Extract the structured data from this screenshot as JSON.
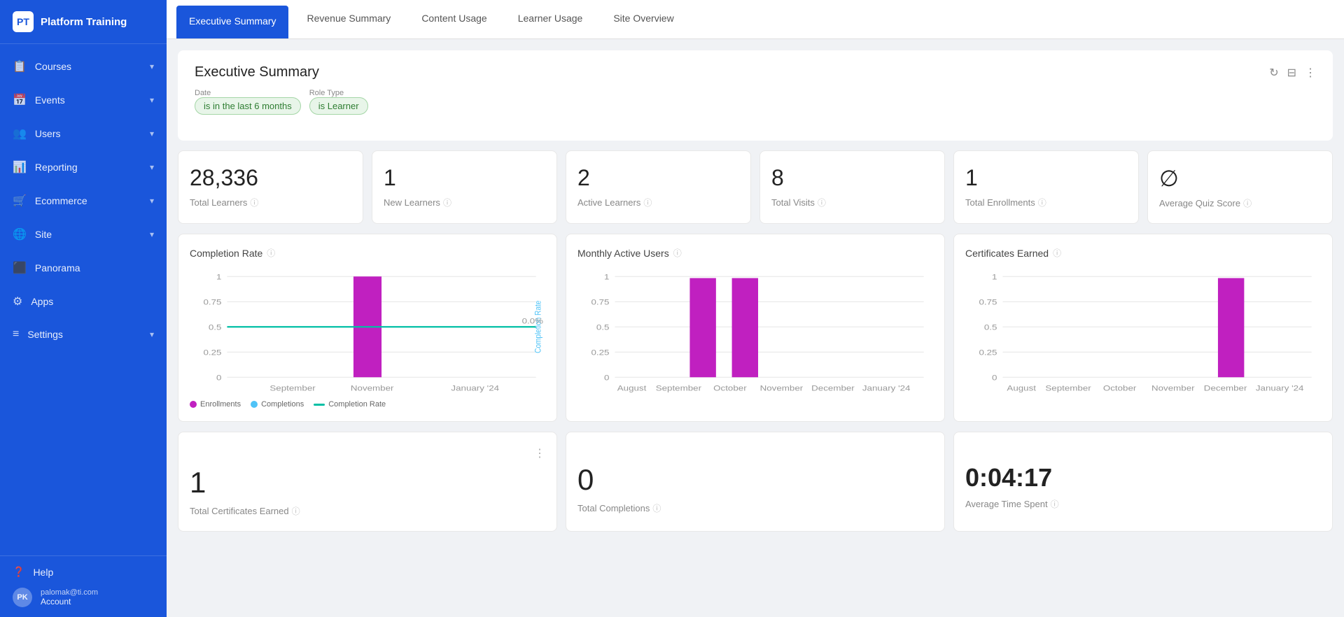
{
  "app": {
    "logo_text": "PT",
    "title": "Platform Training"
  },
  "sidebar": {
    "items": [
      {
        "label": "Courses",
        "icon": "📋",
        "has_chevron": true
      },
      {
        "label": "Events",
        "icon": "📅",
        "has_chevron": true
      },
      {
        "label": "Users",
        "icon": "👥",
        "has_chevron": true
      },
      {
        "label": "Reporting",
        "icon": "📊",
        "has_chevron": true
      },
      {
        "label": "Ecommerce",
        "icon": "🛒",
        "has_chevron": true
      },
      {
        "label": "Site",
        "icon": "🌐",
        "has_chevron": true
      },
      {
        "label": "Panorama",
        "icon": "⬛",
        "has_chevron": false
      },
      {
        "label": "Apps",
        "icon": "⚙",
        "has_chevron": false
      },
      {
        "label": "Settings",
        "icon": "≡",
        "has_chevron": true
      }
    ],
    "footer": {
      "help_label": "Help",
      "user_initials": "PK",
      "user_email": "palomak@ti.com",
      "user_account": "Account"
    }
  },
  "tabs": [
    {
      "label": "Executive Summary",
      "active": true
    },
    {
      "label": "Revenue Summary",
      "active": false
    },
    {
      "label": "Content Usage",
      "active": false
    },
    {
      "label": "Learner Usage",
      "active": false
    },
    {
      "label": "Site Overview",
      "active": false
    }
  ],
  "report": {
    "title": "Executive Summary",
    "filters": {
      "date_label": "Date",
      "date_value": "is in the last 6 months",
      "role_label": "Role Type",
      "role_value": "is Learner"
    },
    "stats": [
      {
        "value": "28,336",
        "label": "Total Learners"
      },
      {
        "value": "1",
        "label": "New Learners"
      },
      {
        "value": "2",
        "label": "Active Learners"
      },
      {
        "value": "8",
        "label": "Total Visits"
      },
      {
        "value": "1",
        "label": "Total Enrollments"
      },
      {
        "value": "∅",
        "label": "Average Quiz Score"
      }
    ],
    "charts": [
      {
        "title": "Completion Rate",
        "legend": [
          {
            "label": "Enrollments",
            "type": "dot",
            "color": "#c020c0"
          },
          {
            "label": "Completions",
            "type": "dot",
            "color": "#4fc3f7"
          },
          {
            "label": "Completion Rate",
            "type": "line",
            "color": "#00bfa5"
          }
        ]
      },
      {
        "title": "Monthly Active Users",
        "legend": []
      },
      {
        "title": "Certificates Earned",
        "legend": []
      }
    ],
    "bottom_cards": [
      {
        "value": "1",
        "label": "Total Certificates Earned",
        "type": "number"
      },
      {
        "value": "0",
        "label": "Total Completions",
        "type": "number"
      },
      {
        "value": "0:04:17",
        "label": "Average Time Spent",
        "type": "time"
      }
    ]
  },
  "icons": {
    "refresh": "↻",
    "filter": "⊟",
    "more": "⋮",
    "info": "ⓘ"
  }
}
